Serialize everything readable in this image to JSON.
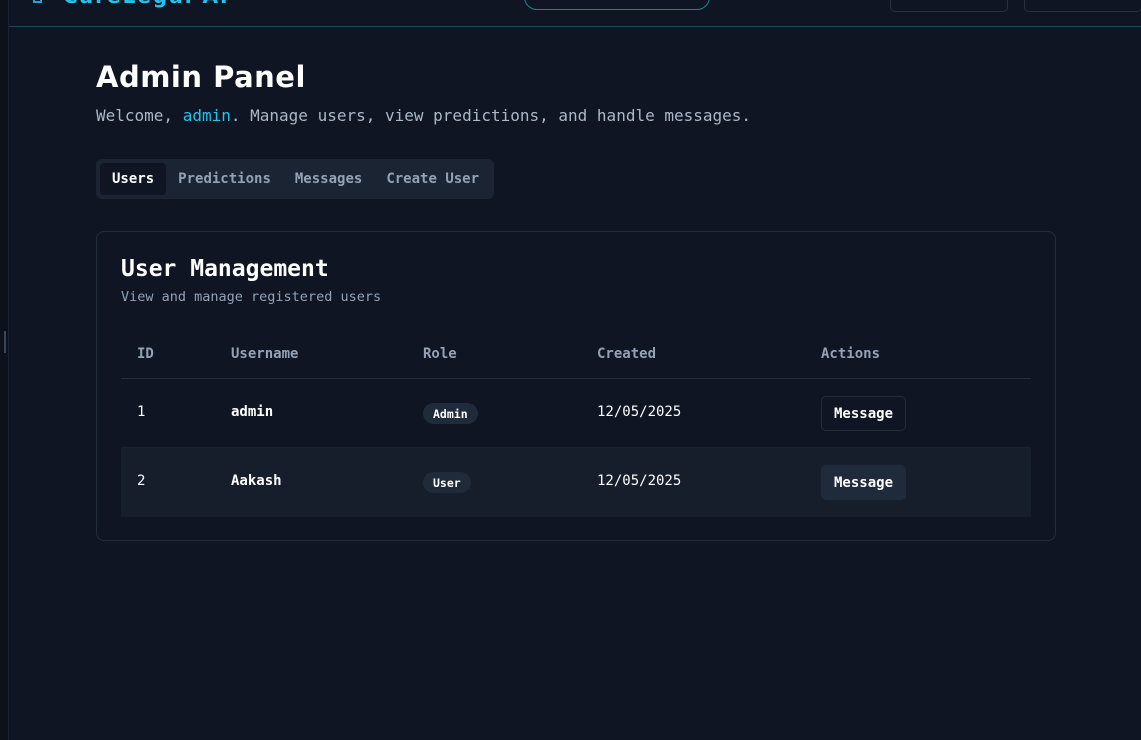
{
  "app": {
    "logo_text": "CareLegal AI",
    "accent_color": "#22c4ef"
  },
  "header": {
    "title": "Admin Panel",
    "welcome_prefix": "Welcome, ",
    "username": "admin",
    "welcome_suffix": ". Manage users, view predictions, and handle messages."
  },
  "tabs": [
    {
      "label": "Users",
      "active": true
    },
    {
      "label": "Predictions",
      "active": false
    },
    {
      "label": "Messages",
      "active": false
    },
    {
      "label": "Create User",
      "active": false
    }
  ],
  "card": {
    "title": "User Management",
    "subtitle": "View and manage registered users"
  },
  "table": {
    "columns": [
      "ID",
      "Username",
      "Role",
      "Created",
      "Actions"
    ],
    "rows": [
      {
        "id": "1",
        "username": "admin",
        "role": "Admin",
        "created": "12/05/2025",
        "action": "Message"
      },
      {
        "id": "2",
        "username": "Aakash",
        "role": "User",
        "created": "12/05/2025",
        "action": "Message"
      }
    ]
  }
}
